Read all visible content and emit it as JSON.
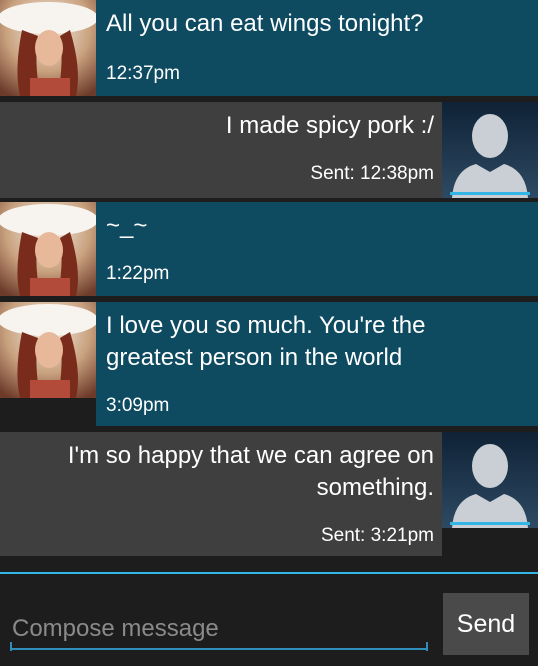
{
  "messages": [
    {
      "direction": "in",
      "lines": [
        "All you can eat wings tonight?"
      ],
      "time": "12:37pm"
    },
    {
      "direction": "out",
      "lines": [
        "I made spicy pork :/"
      ],
      "time": "Sent: 12:38pm"
    },
    {
      "direction": "in",
      "lines": [
        "~_~"
      ],
      "time": "1:22pm"
    },
    {
      "direction": "in",
      "lines": [
        "I love you so much. You're the",
        "greatest person in the world"
      ],
      "time": "3:09pm"
    },
    {
      "direction": "out",
      "lines": [
        "I'm so happy that we can agree on",
        "something."
      ],
      "time": "Sent: 3:21pm"
    }
  ],
  "compose": {
    "placeholder": "Compose message",
    "send_label": "Send"
  },
  "colors": {
    "incoming_bubble": "#0e4b61",
    "outgoing_bubble": "#3f3f3f",
    "background": "#1d1d1d",
    "accent": "#33b5e5"
  },
  "icons": {
    "her_avatar": "contact-photo-icon",
    "my_avatar": "default-person-silhouette-icon"
  }
}
